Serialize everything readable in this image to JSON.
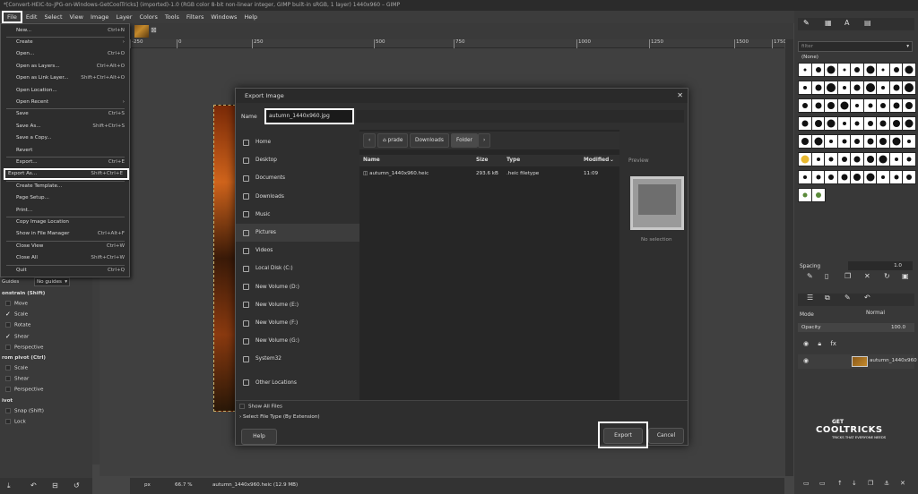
{
  "window": {
    "title": "*[Convert-HEIC-to-JPG-on-Windows-GetCoolTricks] (imported)-1.0 (RGB color 8-bit non-linear integer, GIMP built-in sRGB, 1 layer) 1440x960 – GIMP"
  },
  "menubar": [
    "File",
    "Edit",
    "Select",
    "View",
    "Image",
    "Layer",
    "Colors",
    "Tools",
    "Filters",
    "Windows",
    "Help"
  ],
  "file_menu": [
    {
      "label": "New...",
      "shortcut": "Ctrl+N"
    },
    {
      "label": "Create",
      "shortcut": "›"
    },
    {
      "label": "Open...",
      "shortcut": "Ctrl+O"
    },
    {
      "label": "Open as Layers...",
      "shortcut": "Ctrl+Alt+O"
    },
    {
      "label": "Open as Link Layer...",
      "shortcut": "Shift+Ctrl+Alt+O"
    },
    {
      "label": "Open Location...",
      "shortcut": ""
    },
    {
      "label": "Open Recent",
      "shortcut": "›"
    },
    {
      "label": "Save",
      "shortcut": "Ctrl+S"
    },
    {
      "label": "Save As...",
      "shortcut": "Shift+Ctrl+S"
    },
    {
      "label": "Save a Copy...",
      "shortcut": ""
    },
    {
      "label": "Revert",
      "shortcut": ""
    },
    {
      "label": "Export...",
      "shortcut": "Ctrl+E"
    },
    {
      "label": "Export As...",
      "shortcut": "Shift+Ctrl+E"
    },
    {
      "label": "Create Template...",
      "shortcut": ""
    },
    {
      "label": "Page Setup...",
      "shortcut": ""
    },
    {
      "label": "Print...",
      "shortcut": ""
    },
    {
      "label": "Copy Image Location",
      "shortcut": ""
    },
    {
      "label": "Show in File Manager",
      "shortcut": "Ctrl+Alt+F"
    },
    {
      "label": "Close View",
      "shortcut": "Ctrl+W"
    },
    {
      "label": "Close All",
      "shortcut": "Shift+Ctrl+W"
    },
    {
      "label": "Quit",
      "shortcut": "Ctrl+Q"
    }
  ],
  "tool_options": {
    "guides_label": "Guides",
    "guides_value": "No guides",
    "constrain": "onstrain (Shift)",
    "opts1": [
      {
        "label": "Move",
        "checked": false
      },
      {
        "label": "Scale",
        "checked": true
      },
      {
        "label": "Rotate",
        "checked": false
      },
      {
        "label": "Shear",
        "checked": true
      },
      {
        "label": "Perspective",
        "checked": false
      }
    ],
    "from_pivot": "rom pivot  (Ctrl)",
    "opts2": [
      {
        "label": "Scale",
        "checked": false
      },
      {
        "label": "Shear",
        "checked": false
      },
      {
        "label": "Perspective",
        "checked": false
      }
    ],
    "pivot": "ivot",
    "opts3": [
      {
        "label": "Snap (Shift)",
        "checked": false
      },
      {
        "label": "Lock",
        "checked": false
      }
    ]
  },
  "ruler": [
    "-250",
    "0",
    "250",
    "500",
    "750",
    "1000",
    "1250",
    "1500",
    "1750"
  ],
  "statusbar": {
    "unit": "px",
    "zoom": "66.7 %",
    "file": "autumn_1440x960.heic (12.9 MB)"
  },
  "dialog": {
    "title": "Export Image",
    "name_label": "Name",
    "name_value": "autumn_1440x960.jpg",
    "places": [
      "Home",
      "Desktop",
      "Documents",
      "Downloads",
      "Music",
      "Pictures",
      "Videos",
      "Local Disk (C:)",
      "New Volume (D:)",
      "New Volume (E:)",
      "New Volume (F:)",
      "New Volume (G:)",
      "System32",
      "Other Locations"
    ],
    "path": [
      "prade",
      "Downloads",
      "Folder"
    ],
    "columns": {
      "name": "Name",
      "size": "Size",
      "type": "Type",
      "modified": "Modified"
    },
    "files": [
      {
        "name": "autumn_1440x960.heic",
        "size": "293.6 kB",
        "type": ".heic filetype",
        "modified": "11:09"
      }
    ],
    "preview_label": "Preview",
    "no_selection": "No selection",
    "show_all": "Show All Files",
    "select_type": "Select File Type (By Extension)",
    "help": "Help",
    "export": "Export",
    "cancel": "Cancel"
  },
  "right_panel": {
    "filter_placeholder": "filter",
    "brush_name": "(None)",
    "spacing_label": "Spacing",
    "spacing_value": "1.0",
    "mode_label": "Mode",
    "mode_value": "Normal",
    "opacity_label": "Opacity",
    "opacity_value": "100.0",
    "layer_name": "autumn_1440x960"
  },
  "watermark": {
    "line1": "GET",
    "line2": "COOLTRICKS",
    "tagline": "TRICKS THAT EVERYONE NEEDS"
  }
}
